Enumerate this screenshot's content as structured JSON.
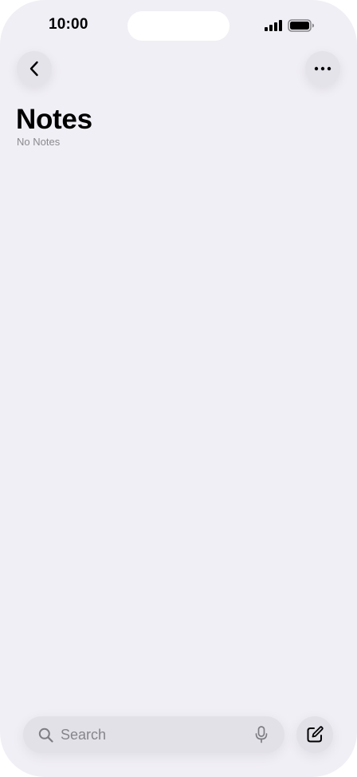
{
  "status_bar": {
    "time": "10:00",
    "signal_icon": "cellular-signal-icon",
    "battery_icon": "battery-full-icon"
  },
  "nav": {
    "back_icon": "chevron-left-icon",
    "more_icon": "ellipsis-icon"
  },
  "header": {
    "title": "Notes",
    "subtitle": "No Notes"
  },
  "bottom_bar": {
    "search_placeholder": "Search",
    "search_icon": "magnifying-glass-icon",
    "mic_icon": "microphone-icon",
    "compose_icon": "compose-icon"
  },
  "colors": {
    "background": "#f0eff5",
    "control_fill": "#e2e1e8",
    "secondary_text": "#8a8a8e"
  }
}
